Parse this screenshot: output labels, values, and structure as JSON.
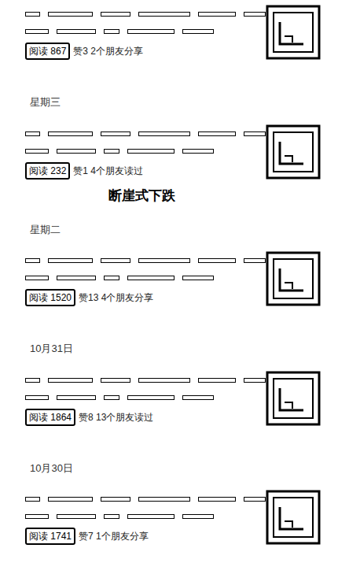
{
  "articles": [
    {
      "date": "",
      "read": "阅读 867",
      "stats": "赞3  2个朋友分享",
      "annotation": ""
    },
    {
      "date": "星期三",
      "read": "阅读 232",
      "stats": "赞1  4个朋友读过",
      "annotation": "断崖式下跌"
    },
    {
      "date": "星期二",
      "read": "阅读 1520",
      "stats": "赞13  4个朋友分享",
      "annotation": ""
    },
    {
      "date": "10月31日",
      "read": "阅读 1864",
      "stats": "赞8  13个朋友读过",
      "annotation": ""
    },
    {
      "date": "10月30日",
      "read": "阅读 1741",
      "stats": "赞7  1个朋友分享",
      "annotation": ""
    }
  ]
}
